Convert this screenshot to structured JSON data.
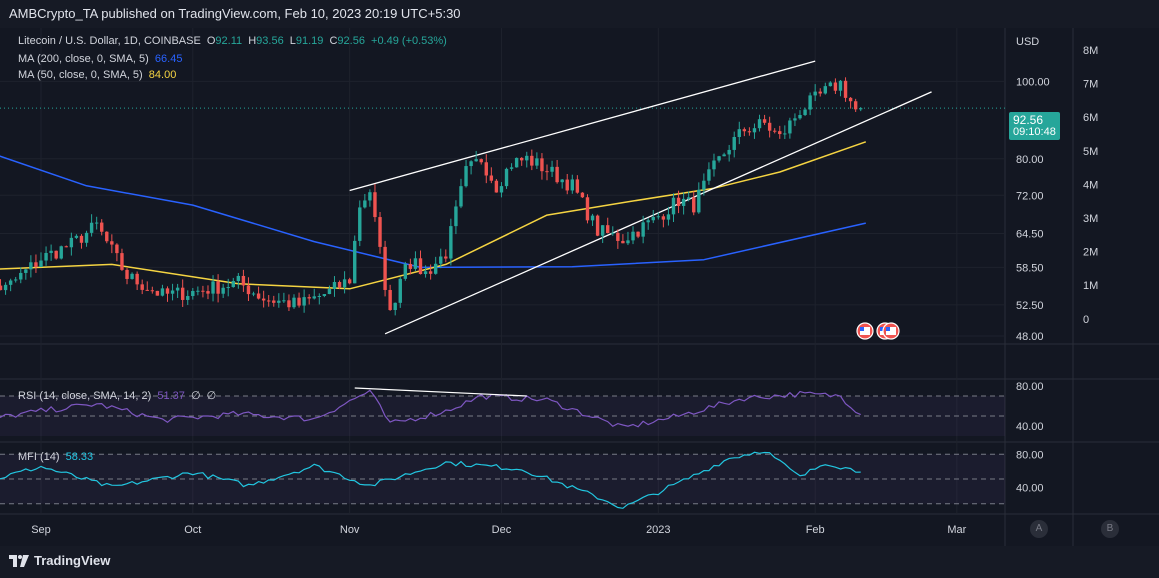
{
  "publisher": "AMBCrypto_TA published on TradingView.com, Feb 10, 2023 20:19 UTC+5:30",
  "footer": {
    "logo_text": "TradingView"
  },
  "colors": {
    "up": "#26a69a",
    "down": "#ef5350",
    "ma200": "#2962ff",
    "ma50": "#f5d442",
    "rsi": "#7e57c2",
    "mfi": "#22c6e0",
    "channel": "#ffffff"
  },
  "legend": {
    "symbol": "Litecoin / U.S. Dollar, 1D, COINBASE",
    "o_k": "O",
    "o_v": "92.11",
    "h_k": "H",
    "h_v": "93.56",
    "l_k": "L",
    "l_v": "91.19",
    "c_k": "C",
    "c_v": "92.56",
    "change": "+0.49 (+0.53%)",
    "ma200_label": "MA (200, close, 0, SMA, 5)",
    "ma200_value": "66.45",
    "ma50_label": "MA (50, close, 0, SMA, 5)",
    "ma50_value": "84.00",
    "rsi_label": "RSI (14, close, SMA, 14, 2)",
    "rsi_value": "51.37",
    "rsi_extra1": "∅",
    "rsi_extra2": "∅",
    "mfi_label": "MFI (14)",
    "mfi_value": "58.33"
  },
  "price_badge": {
    "price": "92.56",
    "countdown": "09:10:48"
  },
  "axis_buttons": {
    "a": "A",
    "b": "B"
  },
  "chart_data": [
    {
      "type": "candlestick",
      "title": "Litecoin / U.S. Dollar, 1D, COINBASE",
      "price_axis_label": "USD",
      "price_ticks": [
        "100.00",
        "92.56",
        "80.00",
        "72.00",
        "64.50",
        "58.50",
        "52.50",
        "48.00"
      ],
      "price_tick_values": [
        100,
        80,
        72,
        64.5,
        58.5,
        52.5,
        48
      ],
      "volume_ticks": [
        "8M",
        "7M",
        "6M",
        "5M",
        "4M",
        "3M",
        "2M",
        "1M",
        "0"
      ],
      "time_ticks": [
        "Sep",
        "Oct",
        "Nov",
        "Dec",
        "2023",
        "Feb",
        "Mar"
      ],
      "time_tick_dates": [
        "2022-09-01",
        "2022-10-01",
        "2022-11-01",
        "2022-12-01",
        "2023-01-01",
        "2023-02-01",
        "2023-03-01"
      ],
      "ylim": [
        48,
        112
      ],
      "log_scale": true,
      "last_price": 92.56,
      "anchors": [
        {
          "date": "2022-08-18",
          "price": 56.5
        },
        {
          "date": "2022-08-25",
          "price": 55.0
        },
        {
          "date": "2022-09-01",
          "price": 60.0
        },
        {
          "date": "2022-09-07",
          "price": 62.5
        },
        {
          "date": "2022-09-12",
          "price": 66.0
        },
        {
          "date": "2022-09-18",
          "price": 57.0
        },
        {
          "date": "2022-09-25",
          "price": 54.0
        },
        {
          "date": "2022-10-01",
          "price": 54.5
        },
        {
          "date": "2022-10-10",
          "price": 56.0
        },
        {
          "date": "2022-10-15",
          "price": 53.5
        },
        {
          "date": "2022-10-22",
          "price": 52.5
        },
        {
          "date": "2022-10-28",
          "price": 54.5
        },
        {
          "date": "2022-11-01",
          "price": 56.5
        },
        {
          "date": "2022-11-03",
          "price": 70.0
        },
        {
          "date": "2022-11-05",
          "price": 73.0
        },
        {
          "date": "2022-11-09",
          "price": 51.0
        },
        {
          "date": "2022-11-12",
          "price": 60.0
        },
        {
          "date": "2022-11-16",
          "price": 57.5
        },
        {
          "date": "2022-11-20",
          "price": 61.0
        },
        {
          "date": "2022-11-24",
          "price": 77.0
        },
        {
          "date": "2022-11-27",
          "price": 80.0
        },
        {
          "date": "2022-11-30",
          "price": 74.0
        },
        {
          "date": "2022-12-03",
          "price": 79.0
        },
        {
          "date": "2022-12-06",
          "price": 80.0
        },
        {
          "date": "2022-12-10",
          "price": 77.5
        },
        {
          "date": "2022-12-15",
          "price": 74.0
        },
        {
          "date": "2022-12-20",
          "price": 65.0
        },
        {
          "date": "2022-12-25",
          "price": 63.5
        },
        {
          "date": "2022-12-31",
          "price": 67.0
        },
        {
          "date": "2023-01-05",
          "price": 71.0
        },
        {
          "date": "2023-01-08",
          "price": 70.0
        },
        {
          "date": "2023-01-12",
          "price": 78.0
        },
        {
          "date": "2023-01-15",
          "price": 83.0
        },
        {
          "date": "2023-01-18",
          "price": 87.0
        },
        {
          "date": "2023-01-22",
          "price": 88.5
        },
        {
          "date": "2023-01-25",
          "price": 85.0
        },
        {
          "date": "2023-01-29",
          "price": 92.0
        },
        {
          "date": "2023-02-03",
          "price": 97.0
        },
        {
          "date": "2023-02-06",
          "price": 99.5
        },
        {
          "date": "2023-02-09",
          "price": 92.0
        },
        {
          "date": "2023-02-10",
          "price": 92.56
        }
      ],
      "series": [
        {
          "name": "MA (200, close, 0, SMA, 5)",
          "last": 66.45,
          "points": [
            {
              "date": "2022-08-18",
              "price": 83.0
            },
            {
              "date": "2022-09-10",
              "price": 74.0
            },
            {
              "date": "2022-10-01",
              "price": 70.0
            },
            {
              "date": "2022-10-25",
              "price": 63.0
            },
            {
              "date": "2022-11-15",
              "price": 58.5
            },
            {
              "date": "2022-12-15",
              "price": 58.6
            },
            {
              "date": "2023-01-10",
              "price": 59.8
            },
            {
              "date": "2023-02-11",
              "price": 66.45
            }
          ]
        },
        {
          "name": "MA (50, close, 0, SMA, 5)",
          "last": 84.0,
          "points": [
            {
              "date": "2022-08-18",
              "price": 58.0
            },
            {
              "date": "2022-09-15",
              "price": 59.0
            },
            {
              "date": "2022-10-10",
              "price": 55.8
            },
            {
              "date": "2022-11-01",
              "price": 55.0
            },
            {
              "date": "2022-11-20",
              "price": 59.0
            },
            {
              "date": "2022-12-10",
              "price": 68.0
            },
            {
              "date": "2022-12-25",
              "price": 70.5
            },
            {
              "date": "2023-01-12",
              "price": 73.5
            },
            {
              "date": "2023-01-25",
              "price": 77.0
            },
            {
              "date": "2023-02-11",
              "price": 84.0
            }
          ]
        }
      ],
      "channel": [
        {
          "from": {
            "date": "2022-11-01",
            "price": 73.0
          },
          "to": {
            "date": "2023-02-01",
            "price": 106.0
          }
        },
        {
          "from": {
            "date": "2022-11-08",
            "price": 48.3
          },
          "to": {
            "date": "2023-02-24",
            "price": 97.0
          }
        }
      ]
    },
    {
      "type": "line",
      "title": "RSI (14, close, SMA, 14, 2)",
      "ticks": [
        "80.00",
        "40.00"
      ],
      "tick_values": [
        80,
        40
      ],
      "ylim": [
        30,
        90
      ],
      "bands": [
        70,
        50
      ],
      "points": [
        {
          "date": "2022-08-18",
          "v": 44
        },
        {
          "date": "2022-09-01",
          "v": 55
        },
        {
          "date": "2022-09-12",
          "v": 62
        },
        {
          "date": "2022-09-25",
          "v": 46
        },
        {
          "date": "2022-10-10",
          "v": 52
        },
        {
          "date": "2022-10-25",
          "v": 47
        },
        {
          "date": "2022-11-05",
          "v": 75
        },
        {
          "date": "2022-11-09",
          "v": 42
        },
        {
          "date": "2022-11-20",
          "v": 55
        },
        {
          "date": "2022-11-27",
          "v": 70
        },
        {
          "date": "2022-12-10",
          "v": 66
        },
        {
          "date": "2022-12-25",
          "v": 38
        },
        {
          "date": "2023-01-05",
          "v": 50
        },
        {
          "date": "2023-01-18",
          "v": 68
        },
        {
          "date": "2023-01-29",
          "v": 72
        },
        {
          "date": "2023-02-06",
          "v": 70
        },
        {
          "date": "2023-02-10",
          "v": 51.37
        }
      ],
      "last": 51.37,
      "trendline": {
        "from": {
          "date": "2022-11-02",
          "v": 78
        },
        "to": {
          "date": "2022-12-06",
          "v": 70
        }
      }
    },
    {
      "type": "line",
      "title": "MFI (14)",
      "ticks": [
        "80.00",
        "40.00"
      ],
      "tick_values": [
        80,
        40
      ],
      "ylim": [
        10,
        90
      ],
      "bands": [
        80,
        50,
        20
      ],
      "points": [
        {
          "date": "2022-08-18",
          "v": 42
        },
        {
          "date": "2022-09-01",
          "v": 65
        },
        {
          "date": "2022-09-15",
          "v": 40
        },
        {
          "date": "2022-10-01",
          "v": 58
        },
        {
          "date": "2022-10-12",
          "v": 42
        },
        {
          "date": "2022-10-25",
          "v": 66
        },
        {
          "date": "2022-11-05",
          "v": 42
        },
        {
          "date": "2022-11-20",
          "v": 70
        },
        {
          "date": "2022-12-05",
          "v": 62
        },
        {
          "date": "2022-12-20",
          "v": 28
        },
        {
          "date": "2022-12-25",
          "v": 15
        },
        {
          "date": "2023-01-05",
          "v": 45
        },
        {
          "date": "2023-01-15",
          "v": 75
        },
        {
          "date": "2023-01-22",
          "v": 85
        },
        {
          "date": "2023-01-29",
          "v": 52
        },
        {
          "date": "2023-02-03",
          "v": 70
        },
        {
          "date": "2023-02-10",
          "v": 58.33
        }
      ],
      "last": 58.33
    }
  ]
}
